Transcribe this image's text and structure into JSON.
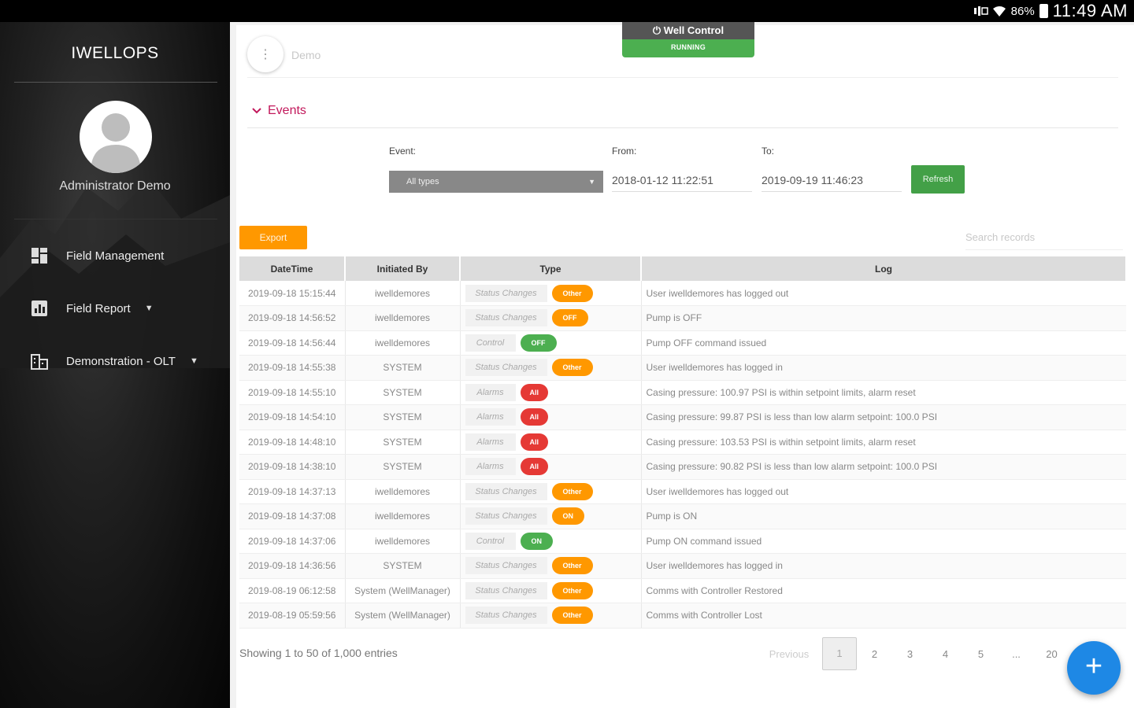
{
  "status_bar": {
    "battery": "86%",
    "time": "11:49 AM"
  },
  "sidebar": {
    "brand": "IWELLOPS",
    "user_name": "Administrator Demo",
    "nav": [
      {
        "label": "Field Management",
        "icon": "dashboard-icon",
        "has_caret": false
      },
      {
        "label": "Field Report",
        "icon": "report-icon",
        "has_caret": true
      },
      {
        "label": "Demonstration - OLT",
        "icon": "building-icon",
        "has_caret": true
      }
    ]
  },
  "header": {
    "breadcrumb": "Demo",
    "well_control": {
      "title": "Well Control",
      "status": "RUNNING"
    }
  },
  "events": {
    "heading": "Events",
    "event_label": "Event:",
    "event_selected": "All types",
    "from_label": "From:",
    "from_value": "2018-01-12 11:22:51",
    "to_label": "To:",
    "to_value": "2019-09-19 11:46:23",
    "refresh_label": "Refresh",
    "export_label": "Export",
    "search_placeholder": "Search records"
  },
  "table": {
    "columns": [
      "DateTime",
      "Initiated By",
      "Type",
      "Log"
    ],
    "rows": [
      {
        "datetime": "2019-09-18 15:15:44",
        "by": "iwelldemores",
        "type": "Status Changes",
        "badge": "Other",
        "log": "User iwelldemores has logged out"
      },
      {
        "datetime": "2019-09-18 14:56:52",
        "by": "iwelldemores",
        "type": "Status Changes",
        "badge": "OFF",
        "log": "Pump is OFF"
      },
      {
        "datetime": "2019-09-18 14:56:44",
        "by": "iwelldemores",
        "type": "Control",
        "badge": "OFF",
        "log": "Pump OFF command issued"
      },
      {
        "datetime": "2019-09-18 14:55:38",
        "by": "SYSTEM",
        "type": "Status Changes",
        "badge": "Other",
        "log": "User iwelldemores has logged in"
      },
      {
        "datetime": "2019-09-18 14:55:10",
        "by": "SYSTEM",
        "type": "Alarms",
        "badge": "All",
        "log": "Casing pressure: 100.97 PSI is within setpoint limits, alarm reset"
      },
      {
        "datetime": "2019-09-18 14:54:10",
        "by": "SYSTEM",
        "type": "Alarms",
        "badge": "All",
        "log": "Casing pressure: 99.87 PSI is less than low alarm setpoint: 100.0 PSI"
      },
      {
        "datetime": "2019-09-18 14:48:10",
        "by": "SYSTEM",
        "type": "Alarms",
        "badge": "All",
        "log": "Casing pressure: 103.53 PSI is within setpoint limits, alarm reset"
      },
      {
        "datetime": "2019-09-18 14:38:10",
        "by": "SYSTEM",
        "type": "Alarms",
        "badge": "All",
        "log": "Casing pressure: 90.82 PSI is less than low alarm setpoint: 100.0 PSI"
      },
      {
        "datetime": "2019-09-18 14:37:13",
        "by": "iwelldemores",
        "type": "Status Changes",
        "badge": "Other",
        "log": "User iwelldemores has logged out"
      },
      {
        "datetime": "2019-09-18 14:37:08",
        "by": "iwelldemores",
        "type": "Status Changes",
        "badge": "ON",
        "log": "Pump is ON"
      },
      {
        "datetime": "2019-09-18 14:37:06",
        "by": "iwelldemores",
        "type": "Control",
        "badge": "ON",
        "log": "Pump ON command issued"
      },
      {
        "datetime": "2019-09-18 14:36:56",
        "by": "SYSTEM",
        "type": "Status Changes",
        "badge": "Other",
        "log": "User iwelldemores has logged in"
      },
      {
        "datetime": "2019-08-19 06:12:58",
        "by": "System (WellManager)",
        "type": "Status Changes",
        "badge": "Other",
        "log": "Comms with Controller Restored"
      },
      {
        "datetime": "2019-08-19 05:59:56",
        "by": "System (WellManager)",
        "type": "Status Changes",
        "badge": "Other",
        "log": "Comms with Controller Lost"
      }
    ]
  },
  "footer": {
    "showing": "Showing 1 to 50 of 1,000 entries",
    "previous": "Previous",
    "pages": [
      "1",
      "2",
      "3",
      "4",
      "5",
      "...",
      "20"
    ],
    "active_page": "1"
  },
  "fab_label": "+"
}
